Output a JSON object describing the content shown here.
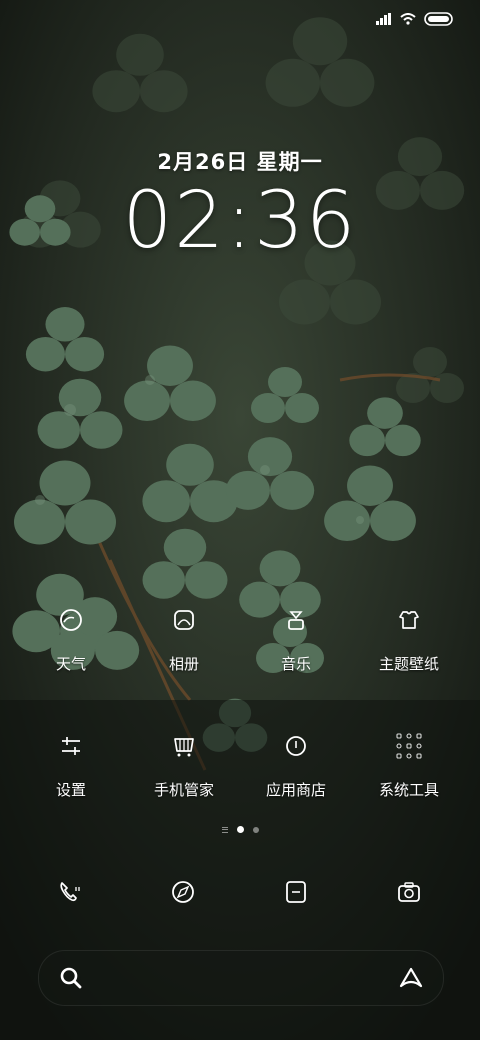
{
  "status_bar": {
    "signal": "signal-icon",
    "wifi": "wifi-icon",
    "battery": "battery-icon"
  },
  "lock": {
    "date": "2月26日 星期一",
    "time": "02:36"
  },
  "apps": [
    {
      "label": "天气",
      "icon": "weather-icon"
    },
    {
      "label": "相册",
      "icon": "gallery-icon"
    },
    {
      "label": "音乐",
      "icon": "music-icon"
    },
    {
      "label": "主题壁纸",
      "icon": "themes-icon"
    },
    {
      "label": "设置",
      "icon": "settings-icon"
    },
    {
      "label": "手机管家",
      "icon": "security-icon"
    },
    {
      "label": "应用商店",
      "icon": "app-store-icon"
    },
    {
      "label": "系统工具",
      "icon": "tools-folder-icon"
    }
  ],
  "page_indicator": {
    "pages": 2,
    "current": 1
  },
  "dock": [
    "phone-icon",
    "browser-icon",
    "messages-icon",
    "camera-icon"
  ],
  "search": {
    "icon": "search-icon",
    "assistant_icon": "assistant-icon"
  },
  "colors": {
    "leaf": "#4f6b55",
    "leaf_light": "#7d9a83",
    "background": "#1b2119"
  }
}
